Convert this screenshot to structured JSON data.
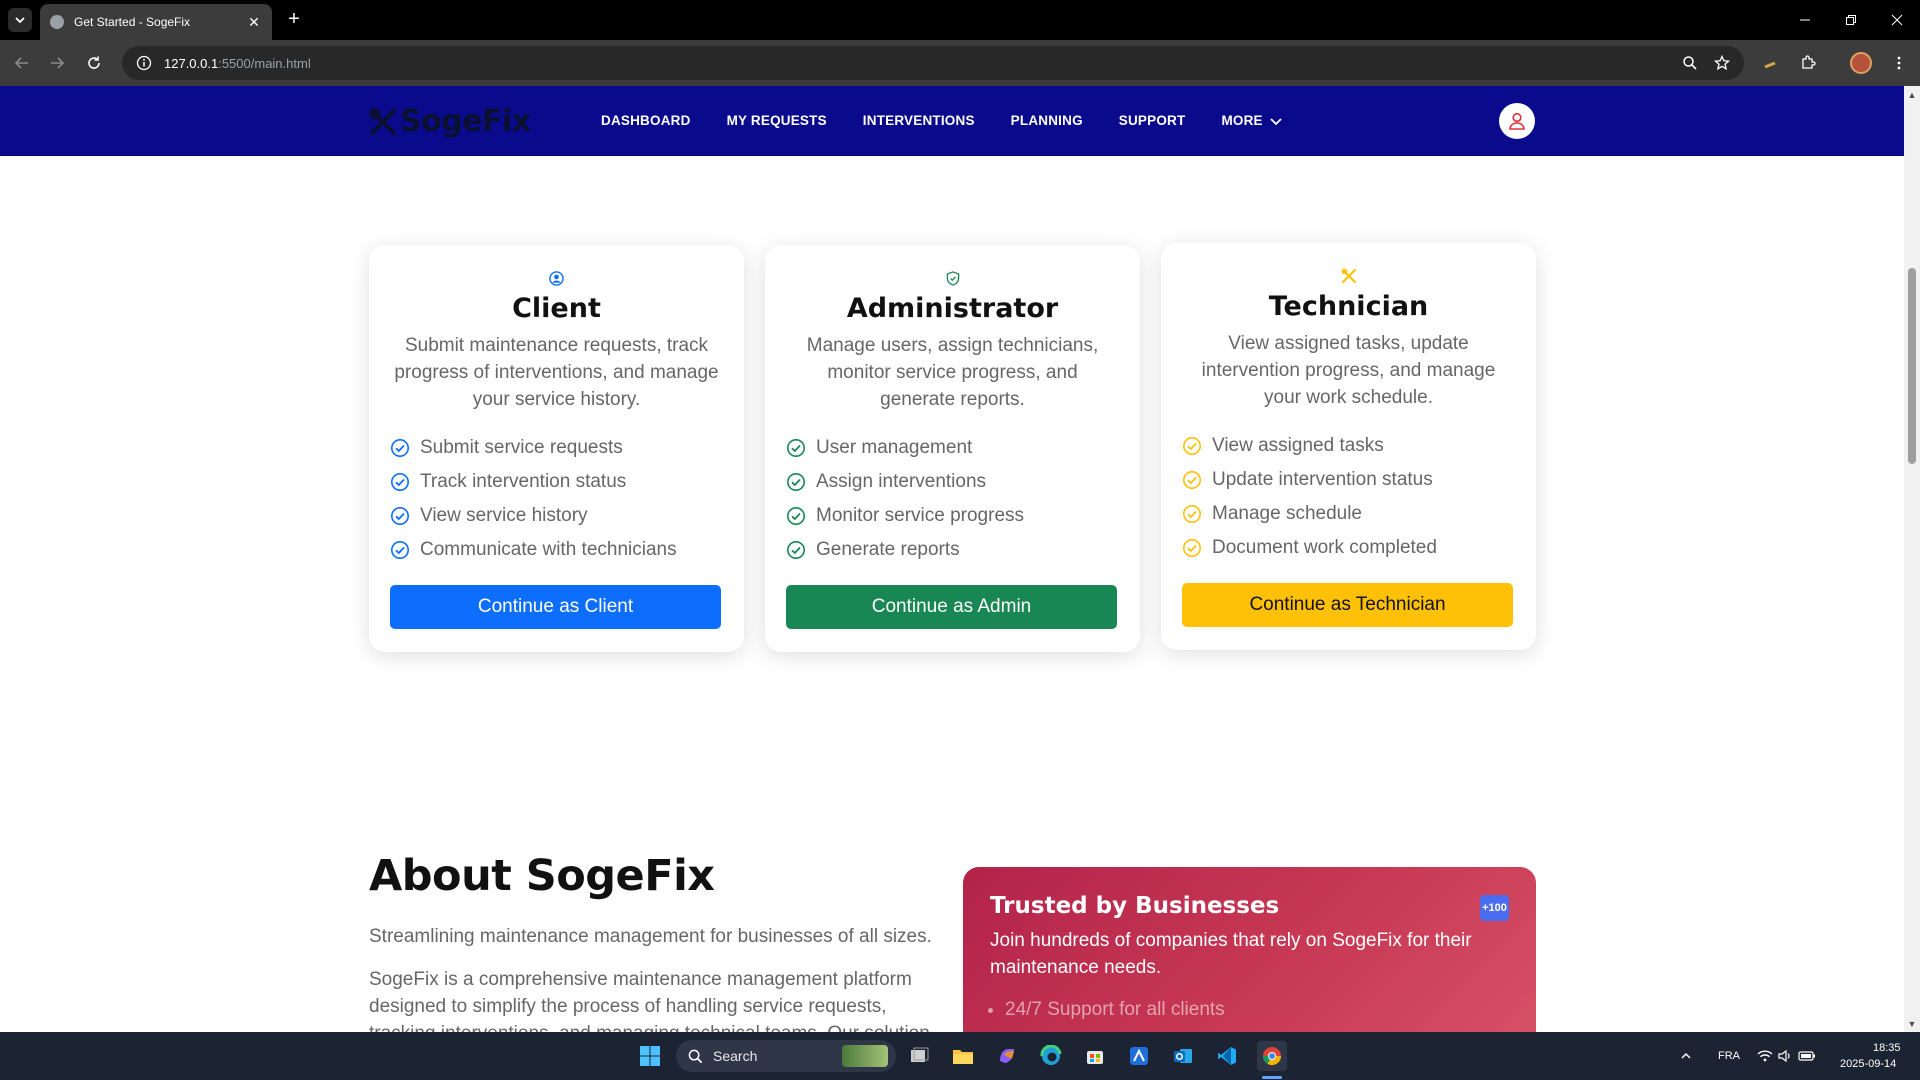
{
  "browser": {
    "tab_title": "Get Started - SogeFix",
    "url_host": "127.0.0.1",
    "url_path": ":5500/main.html"
  },
  "navbar": {
    "brand": "SogeFix",
    "links": [
      "DASHBOARD",
      "MY REQUESTS",
      "INTERVENTIONS",
      "PLANNING",
      "SUPPORT",
      "MORE"
    ]
  },
  "roles": [
    {
      "title": "Client",
      "description": "Submit maintenance requests, track progress of interventions, and manage your service history.",
      "features": [
        "Submit service requests",
        "Track intervention status",
        "View service history",
        "Communicate with technicians"
      ],
      "button": "Continue as Client",
      "accent": "#0d6efd"
    },
    {
      "title": "Administrator",
      "description": "Manage users, assign technicians, monitor service progress, and generate reports.",
      "features": [
        "User management",
        "Assign interventions",
        "Monitor service progress",
        "Generate reports"
      ],
      "button": "Continue as Admin",
      "accent": "#198754"
    },
    {
      "title": "Technician",
      "description": "View assigned tasks, update intervention progress, and manage your work schedule.",
      "features": [
        "View assigned tasks",
        "Update intervention status",
        "Manage schedule",
        "Document work completed"
      ],
      "button": "Continue as Technician",
      "accent": "#ffc107"
    }
  ],
  "about": {
    "title": "About SogeFix",
    "lead": "Streamlining maintenance management for businesses of all sizes.",
    "body": "SogeFix is a comprehensive maintenance management platform designed to simplify the process of handling service requests, tracking interventions, and managing technical teams. Our solution"
  },
  "trusted": {
    "title": "Trusted by Businesses",
    "badge": "+100",
    "description": "Join hundreds of companies that rely on SogeFix for their maintenance needs.",
    "list": [
      "24/7 Support for all clients"
    ]
  },
  "taskbar": {
    "search_placeholder": "Search",
    "language": "FRA",
    "time": "18:35",
    "date": "2025-09-14"
  }
}
